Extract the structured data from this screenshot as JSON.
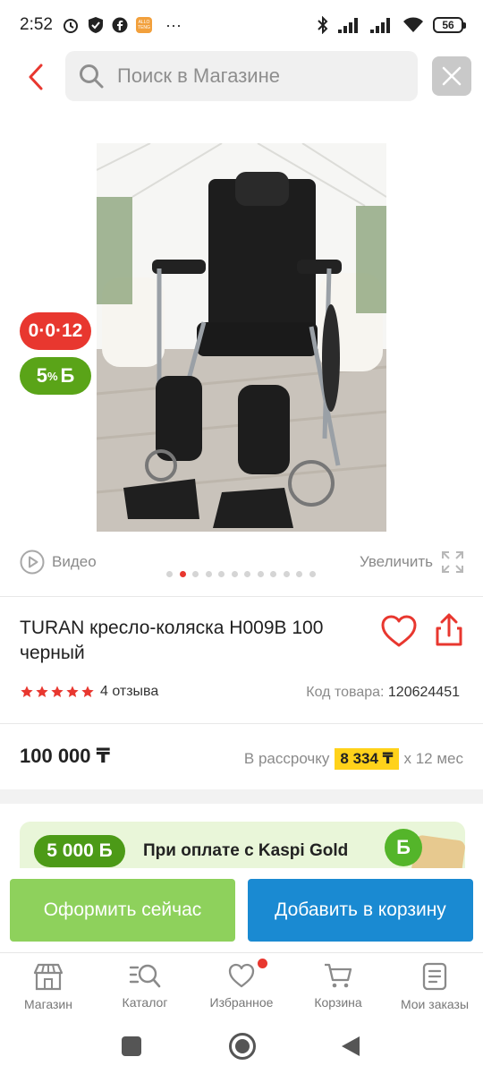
{
  "status_bar": {
    "time": "2:52",
    "battery": "56",
    "app_badge": "ALLO TENG",
    "more": "···"
  },
  "search": {
    "placeholder": "Поиск в Магазине"
  },
  "badges": {
    "installment": "0·0·12",
    "bonus": "5",
    "bonus_suffix": "%",
    "bonus_currency": "Б"
  },
  "gallery": {
    "video_label": "Видео",
    "zoom_label": "Увеличить",
    "total_images": 12,
    "active_index": 1
  },
  "product": {
    "title": "TURAN кресло-коляска H009B 100 черный",
    "rating_stars": 5,
    "reviews": "4 отзыва",
    "code_label": "Код товара:",
    "code_value": "120624451",
    "price": "100 000 ₸",
    "installment_prefix": "В рассрочку",
    "installment_amount": "8 334 ₸",
    "installment_suffix": "х 12 мес"
  },
  "promo": {
    "bonus_amount": "5 000 Б",
    "text": "При оплате с Kaspi Gold",
    "coin": "Б"
  },
  "actions": {
    "order_now": "Оформить сейчас",
    "add_to_cart": "Добавить в корзину"
  },
  "bottom_nav": [
    {
      "label": "Магазин",
      "icon": "shop-icon"
    },
    {
      "label": "Каталог",
      "icon": "catalog-search-icon"
    },
    {
      "label": "Избранное",
      "icon": "heart-icon",
      "has_dot": true
    },
    {
      "label": "Корзина",
      "icon": "cart-icon"
    },
    {
      "label": "Мои заказы",
      "icon": "orders-icon"
    }
  ],
  "colors": {
    "accent_red": "#e8372f",
    "bonus_green": "#5aa418",
    "order_button": "#8ed15c",
    "cart_button": "#1a8ad2",
    "installment_highlight": "#ffd21a"
  }
}
